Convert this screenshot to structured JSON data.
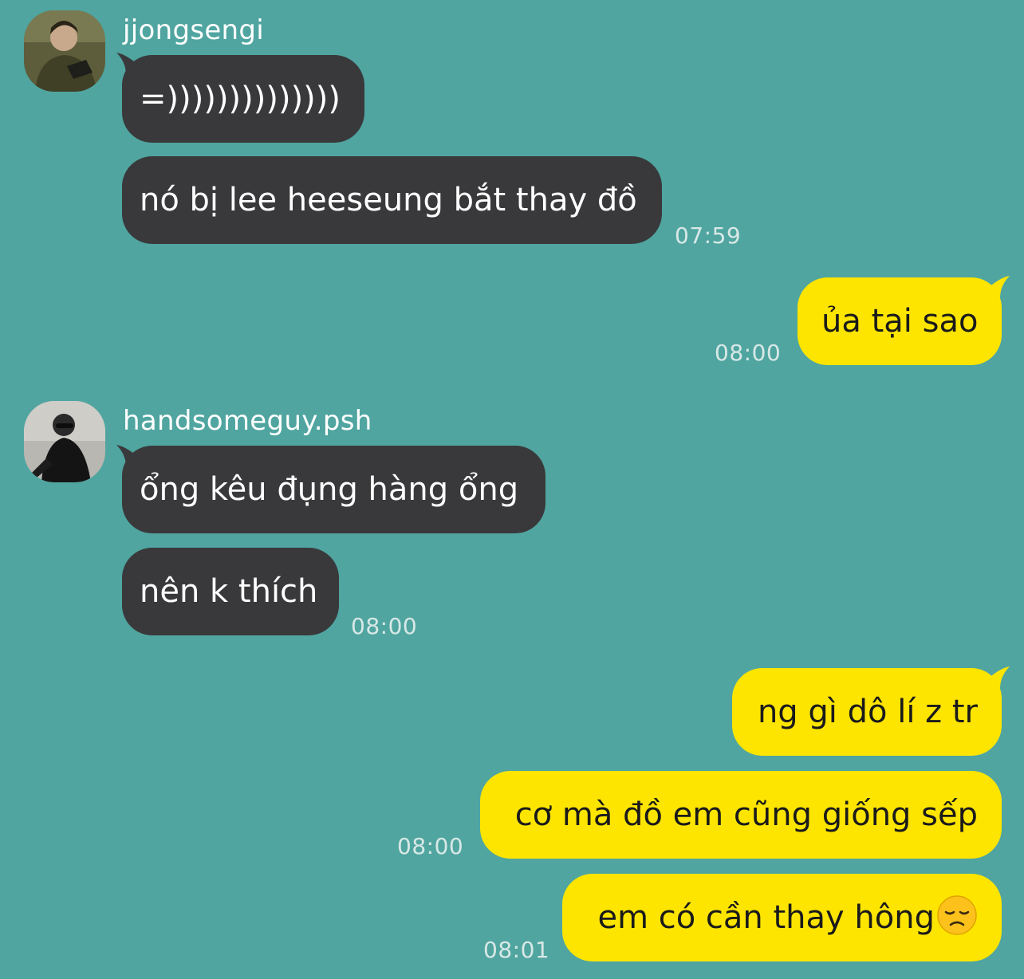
{
  "messages": [
    {
      "sender": "jjongsengi",
      "avatar_icon": "avatar-photo-icon",
      "bubbles": [
        "=))))))))))))))",
        "nó bị lee heeseung bắt thay đồ"
      ],
      "time": "07:59"
    },
    {
      "outgoing": true,
      "bubbles": [
        "ủa tại sao"
      ],
      "time": "08:00"
    },
    {
      "sender": "handsomeguy.psh",
      "avatar_icon": "avatar-photo-icon",
      "bubbles": [
        "ổng kêu đụng hàng ổng",
        "nên k thích"
      ],
      "time": "08:00"
    },
    {
      "outgoing": true,
      "bubbles": [
        "ng gì dô lí z tr",
        "cơ mà đồ em cũng giống sếp"
      ],
      "time": "08:00"
    },
    {
      "outgoing": true,
      "bubbles": [
        "em có cần thay hông"
      ],
      "emoji": "disappointed-face-icon",
      "time": "08:01"
    }
  ],
  "colors": {
    "background": "#50a5a0",
    "incoming_bubble": "#39393b",
    "outgoing_bubble": "#fee500"
  }
}
